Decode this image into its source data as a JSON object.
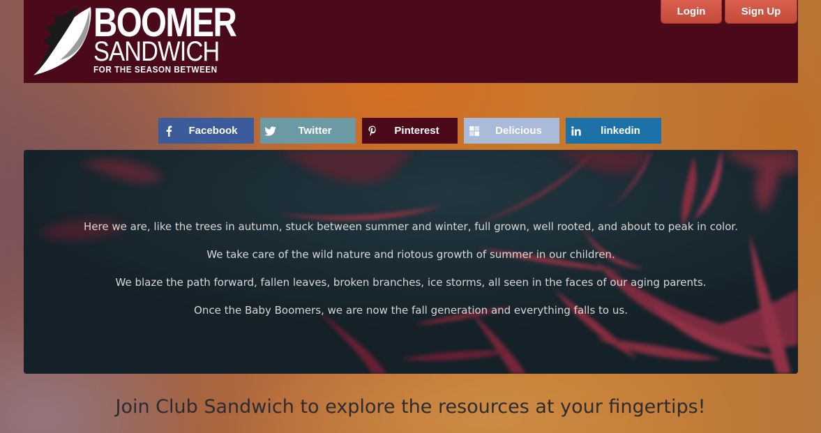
{
  "header": {
    "logo": {
      "line1": "BOOMER",
      "line2": "SANDWICH",
      "tagline": "FOR THE SEASON BETWEEN"
    },
    "login_label": "Login",
    "signup_label": "Sign Up"
  },
  "share": [
    {
      "label": "Facebook",
      "icon": "facebook-icon",
      "color": "#3b5b9a"
    },
    {
      "label": "Twitter",
      "icon": "twitter-icon",
      "color": "#6b9aa4"
    },
    {
      "label": "Pinterest",
      "icon": "pinterest-icon",
      "color": "#4a0a1a"
    },
    {
      "label": "Delicious",
      "icon": "delicious-icon",
      "color": "#a9bbd8"
    },
    {
      "label": "linkedin",
      "icon": "linkedin-icon",
      "color": "#1c72a8"
    }
  ],
  "hero": {
    "lines": [
      "Here we are, like the trees in autumn, stuck between summer and winter, full grown, well rooted, and about to peak in color.",
      "We take care of the wild nature and riotous growth of summer in our children.",
      "We blaze the path forward, fallen leaves, broken branches, ice storms, all seen in the faces of our aging parents.",
      "Once the Baby Boomers, we are now the fall generation and everything falls to us."
    ]
  },
  "join_text": "Join Club Sandwich to explore the resources at your fingertips!",
  "colors": {
    "header_bg": "#4a0a1a",
    "button_red": "#c44a3a"
  }
}
